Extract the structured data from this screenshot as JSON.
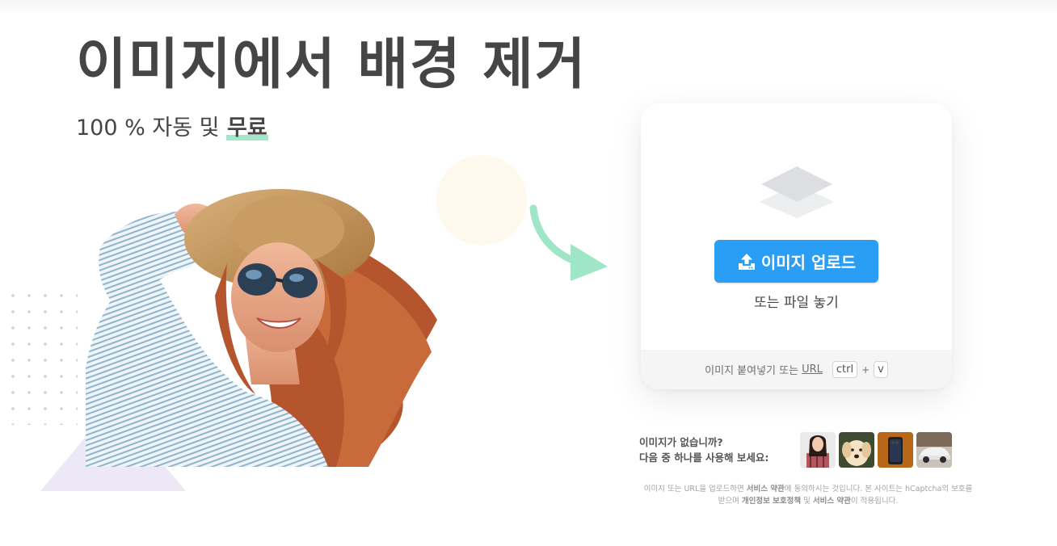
{
  "hero": {
    "title": "이미지에서 배경 제거",
    "subtitle_prefix": "100 % 자동 및 ",
    "subtitle_highlight": "무료"
  },
  "upload": {
    "button_label": "이미지 업로드",
    "drop_text": "또는 파일 놓기",
    "paste_text": "이미지 붙여넣기 또는",
    "url_link": "URL",
    "key_ctrl": "ctrl",
    "key_plus": "+",
    "key_v": "v"
  },
  "samples": {
    "line1": "이미지가 없습니까?",
    "line2": "다음 중 하나를 사용해 보세요:"
  },
  "legal": {
    "p1": "이미지 또는 URL을 업로드하면 ",
    "terms1": "서비스 약관",
    "p2": "에 동의하시는 것입니다. 본 사이트는 hCaptcha의 보호를 받으며 ",
    "privacy": "개인정보 보호정책",
    "p3": " 및 ",
    "terms2": "서비스 약관",
    "p4": "이 적용됩니다."
  },
  "colors": {
    "primary": "#2a9df4",
    "highlight": "#a2e7c8",
    "arrow": "#9fe6c6",
    "text": "#454545"
  },
  "icons": {
    "upload": "upload-icon",
    "layers": "layers-icon",
    "arrow": "curved-arrow-icon"
  }
}
